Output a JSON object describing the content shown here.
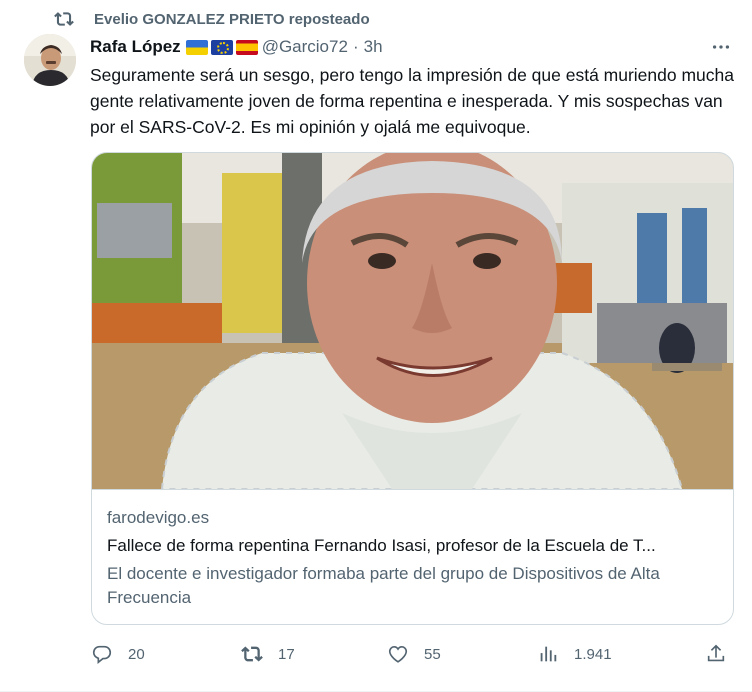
{
  "repost": {
    "label": "Evelio GONZALEZ PRIETO reposteado"
  },
  "author": {
    "name": "Rafa López",
    "handle": "@Garcio72",
    "separator": "·",
    "time": "3h",
    "flags": [
      "ukraine",
      "european-union",
      "spain"
    ]
  },
  "tweet": {
    "text": "Seguramente será un sesgo, pero tengo la impresión de que está muriendo mucha gente relativamente joven de forma repentina e inesperada. Y mis sospechas van por el SARS-CoV-2. Es mi opinión y ojalá me equivoque."
  },
  "card": {
    "domain": "farodevigo.es",
    "title": "Fallece de forma repentina Fernando Isasi, profesor de la Escuela de T...",
    "description": "El docente e investigador formaba parte del grupo de Dispositivos de Alta Frecuencia"
  },
  "actions": {
    "replies": "20",
    "reposts": "17",
    "likes": "55",
    "views": "1.941"
  },
  "colors": {
    "text": "#0f1419",
    "muted": "#536471",
    "border": "#cfd9de"
  }
}
